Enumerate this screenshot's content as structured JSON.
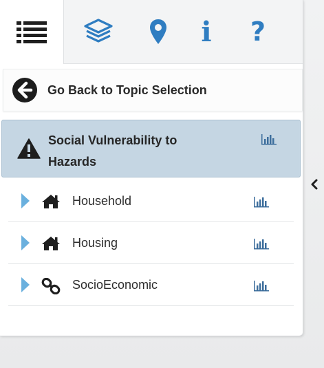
{
  "tabs": [
    {
      "name": "list",
      "icon": "list-icon"
    },
    {
      "name": "layers",
      "icon": "layers-icon"
    },
    {
      "name": "location",
      "icon": "map-marker-icon"
    },
    {
      "name": "info",
      "icon": "info-icon",
      "glyph": "i"
    },
    {
      "name": "help",
      "icon": "help-icon",
      "glyph": "?"
    }
  ],
  "back": {
    "label": "Go Back to Topic Selection",
    "icon": "arrow-circle-left-icon"
  },
  "topic": {
    "title": "Social Vulnerability to Hazards",
    "icon": "warning-icon",
    "chart_icon": "bar-chart-icon",
    "selected": true
  },
  "subtopics": [
    {
      "label": "Household",
      "icon": "home-icon",
      "chart_icon": "bar-chart-icon"
    },
    {
      "label": "Housing",
      "icon": "home-icon",
      "chart_icon": "bar-chart-icon"
    },
    {
      "label": "SocioEconomic",
      "icon": "link-icon",
      "chart_icon": "bar-chart-icon"
    }
  ],
  "collapse_icon": "chevron-left-icon",
  "colors": {
    "accent_blue": "#2f7dc1",
    "selected_bg": "#c5d6e3",
    "caret_blue": "#6ab0de"
  }
}
